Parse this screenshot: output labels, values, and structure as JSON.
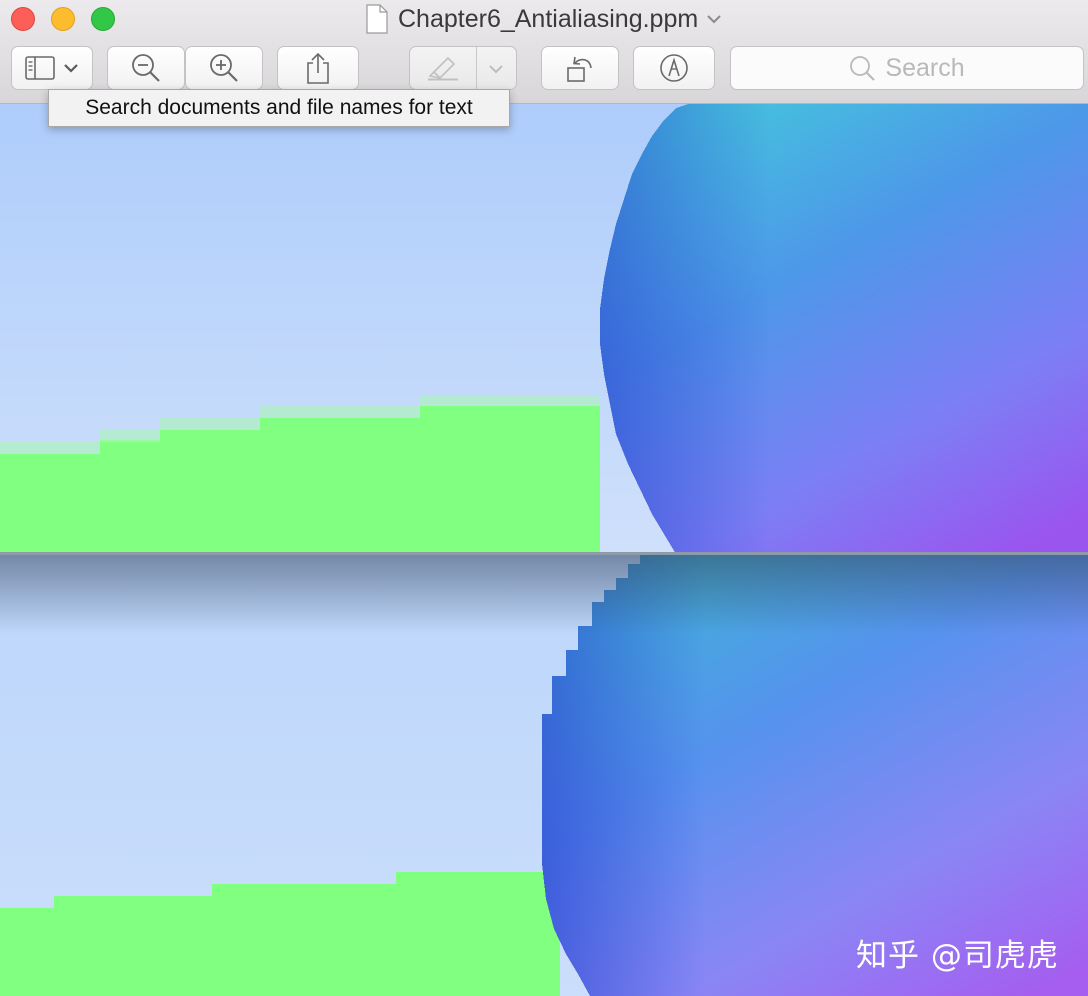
{
  "window": {
    "title": "Chapter6_Antialiasing.ppm",
    "traffic_lights": {
      "close": "#fc5f57",
      "minimize": "#fdbc2e",
      "zoom": "#33c748"
    }
  },
  "toolbar": {
    "buttons": [
      {
        "name": "sidebar-view-menu",
        "icon": "sidebar-icon"
      },
      {
        "name": "zoom-out",
        "icon": "zoom-out-icon"
      },
      {
        "name": "zoom-in",
        "icon": "zoom-in-icon"
      },
      {
        "name": "share",
        "icon": "share-icon"
      },
      {
        "name": "highlight",
        "icon": "highlighter-icon",
        "enabled": false
      },
      {
        "name": "rotate",
        "icon": "rotate-icon"
      },
      {
        "name": "markup",
        "icon": "markup-pen-icon"
      }
    ],
    "search": {
      "placeholder": "Search",
      "icon": "search-icon"
    }
  },
  "tooltip": {
    "text": "Search documents and file names for text"
  },
  "image": {
    "sky_color": "#c6dcfb",
    "ground_color": "#80ff80",
    "sphere_colors": [
      "#43c6dc",
      "#5593ee",
      "#4a3fe0",
      "#a55ef0"
    ]
  },
  "watermark": "知乎 @司虎虎"
}
